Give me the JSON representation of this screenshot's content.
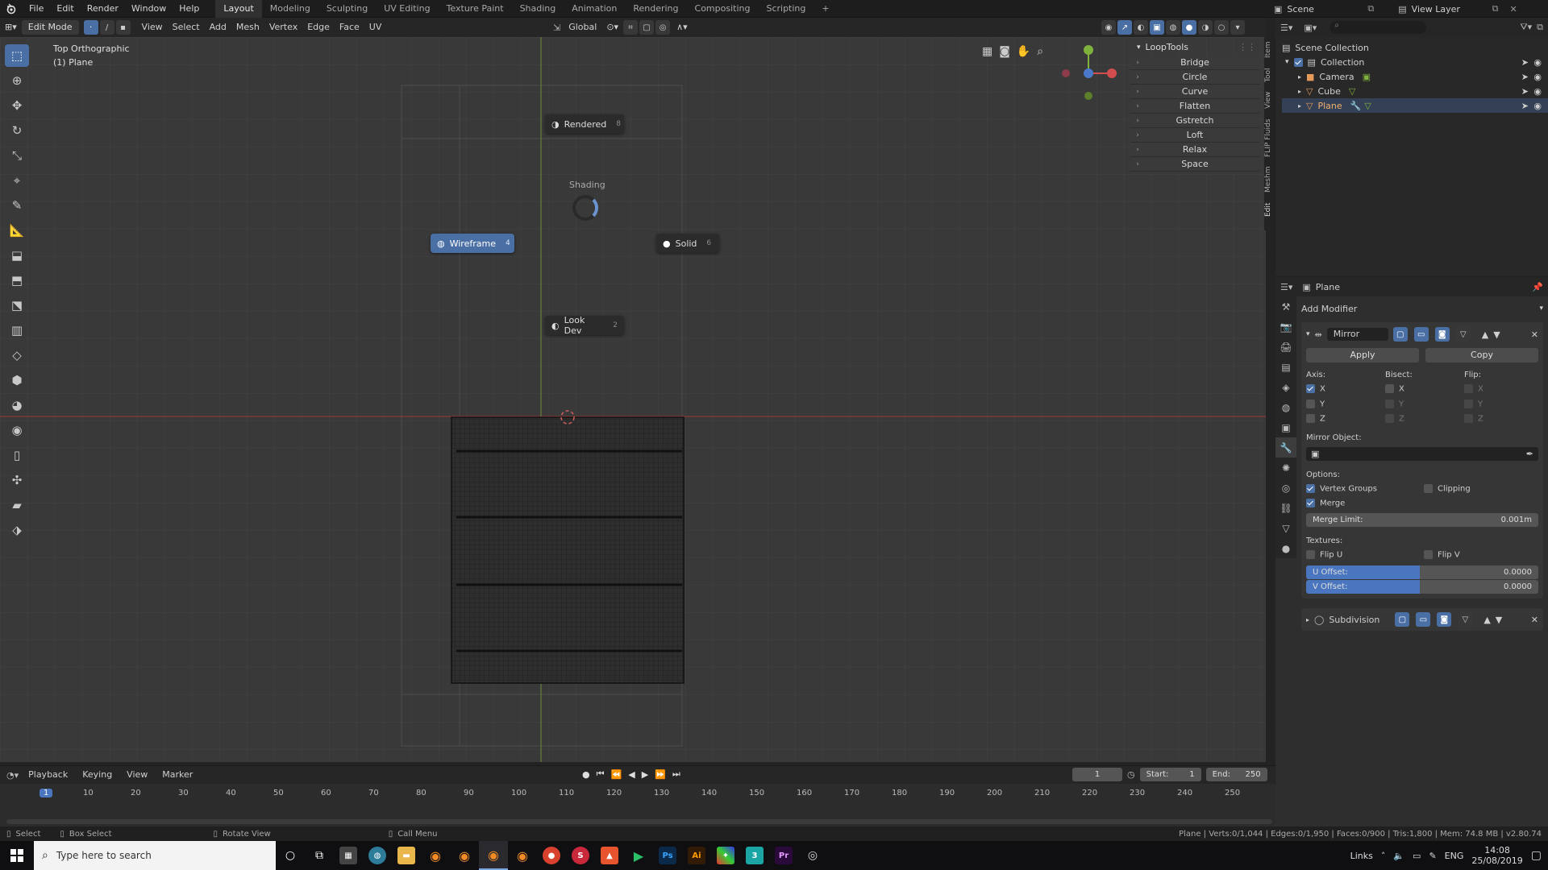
{
  "menu": [
    "File",
    "Edit",
    "Render",
    "Window",
    "Help"
  ],
  "workspaces": [
    {
      "label": "Layout",
      "active": true
    },
    {
      "label": "Modeling"
    },
    {
      "label": "Sculpting"
    },
    {
      "label": "UV Editing"
    },
    {
      "label": "Texture Paint"
    },
    {
      "label": "Shading"
    },
    {
      "label": "Animation"
    },
    {
      "label": "Rendering"
    },
    {
      "label": "Compositing"
    },
    {
      "label": "Scripting"
    }
  ],
  "scene": {
    "label": "Scene",
    "view_layer": "View Layer"
  },
  "header": {
    "mode": "Edit Mode",
    "items": [
      "View",
      "Select",
      "Add",
      "Mesh",
      "Vertex",
      "Edge",
      "Face",
      "UV"
    ],
    "orientation": "Global"
  },
  "viewport": {
    "view_name": "Top Orthographic",
    "object_name": "(1) Plane"
  },
  "pie": {
    "title": "Shading",
    "rendered": {
      "label": "Rendered",
      "key": "8"
    },
    "wireframe": {
      "label": "Wireframe",
      "key": "4"
    },
    "solid": {
      "label": "Solid",
      "key": "6"
    },
    "lookdev": {
      "label": "Look Dev",
      "key": "2"
    }
  },
  "looptools": {
    "title": "LoopTools",
    "items": [
      "Bridge",
      "Circle",
      "Curve",
      "Flatten",
      "Gstretch",
      "Loft",
      "Relax",
      "Space"
    ]
  },
  "side_tabs": [
    "Item",
    "Tool",
    "View",
    "FLIP Fluids",
    "Meshm",
    "Edit"
  ],
  "outliner": {
    "root": "Scene Collection",
    "collection": "Collection",
    "objects": [
      {
        "name": "Camera",
        "color": "#e59a5a"
      },
      {
        "name": "Cube",
        "color": "#e59a5a"
      },
      {
        "name": "Plane",
        "color": "#e59a5a",
        "active": true
      }
    ]
  },
  "properties": {
    "object": "Plane",
    "add_modifier": "Add Modifier",
    "mirror": {
      "name": "Mirror",
      "apply": "Apply",
      "copy": "Copy",
      "axis_label": "Axis:",
      "bisect_label": "Bisect:",
      "flip_label": "Flip:",
      "axes": [
        "X",
        "Y",
        "Z"
      ],
      "mirror_object_label": "Mirror Object:",
      "options_label": "Options:",
      "vertex_groups": "Vertex Groups",
      "clipping": "Clipping",
      "merge": "Merge",
      "merge_limit_label": "Merge Limit:",
      "merge_limit": "0.001m",
      "textures_label": "Textures:",
      "flip_u": "Flip U",
      "flip_v": "Flip V",
      "u_offset_label": "U Offset:",
      "u_offset": "0.0000",
      "v_offset_label": "V Offset:",
      "v_offset": "0.0000"
    },
    "subdivision": {
      "name": "Subdivision"
    }
  },
  "timeline": {
    "menus": [
      "Playback",
      "Keying",
      "View",
      "Marker"
    ],
    "current": "1",
    "start_label": "Start:",
    "start": "1",
    "end_label": "End:",
    "end": "250",
    "ticks": [
      "1",
      "10",
      "20",
      "30",
      "40",
      "50",
      "60",
      "70",
      "80",
      "90",
      "100",
      "110",
      "120",
      "130",
      "140",
      "150",
      "160",
      "170",
      "180",
      "190",
      "200",
      "210",
      "220",
      "230",
      "240",
      "250"
    ]
  },
  "status": {
    "select": "Select",
    "box_select": "Box Select",
    "rotate": "Rotate View",
    "call_menu": "Call Menu",
    "info": "Plane | Verts:0/1,044 | Edges:0/1,950 | Faces:0/900 | Tris:1,800 | Mem: 74.8 MB | v2.80.74"
  },
  "taskbar": {
    "search_placeholder": "Type here to search",
    "tray": [
      "Links",
      "ENG"
    ],
    "time": "14:08",
    "date": "25/08/2019"
  }
}
